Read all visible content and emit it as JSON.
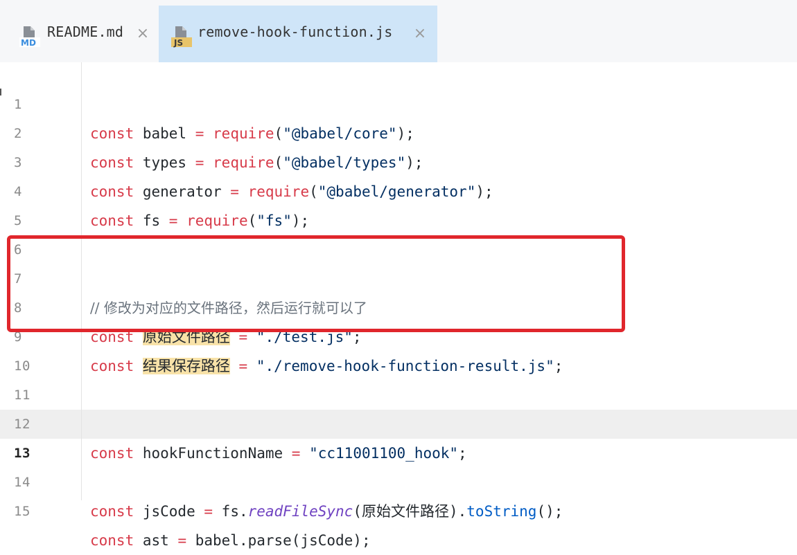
{
  "tabs": [
    {
      "icon": "markdown-file-icon",
      "badge": "MD",
      "label": "README.md",
      "close": "×",
      "active": false
    },
    {
      "icon": "javascript-file-icon",
      "badge": "JS",
      "label": "remove-hook-function.js",
      "close": "×",
      "active": true
    }
  ],
  "colors": {
    "highlight_box": "#e0262c",
    "active_tab": "#cfe5f8",
    "keyword": "#d73a49",
    "string": "#032f62"
  },
  "lines": {
    "l1": {
      "n": "1",
      "kw": "const",
      "name": " babel ",
      "op": "=",
      "fn": " require",
      "open": "(",
      "str": "\"@babel/core\"",
      "close": ");"
    },
    "l2": {
      "n": "2",
      "kw": "const",
      "name": " types ",
      "op": "=",
      "fn": " require",
      "open": "(",
      "str": "\"@babel/types\"",
      "close": ");"
    },
    "l3": {
      "n": "3",
      "kw": "const",
      "name": " generator ",
      "op": "=",
      "fn": " require",
      "open": "(",
      "str": "\"@babel/generator\"",
      "close": ");"
    },
    "l4": {
      "n": "4",
      "kw": "const",
      "name": " fs ",
      "op": "=",
      "fn": " require",
      "open": "(",
      "str": "\"fs\"",
      "close": ");"
    },
    "l5": {
      "n": "5"
    },
    "l6": {
      "n": "6"
    },
    "l7": {
      "n": "7",
      "comment": "// 修改为对应的文件路径，然后运行就可以了"
    },
    "l8": {
      "n": "8",
      "kw": "const",
      "var": "原始文件路径",
      "op": "=",
      "str": "\"./test.js\"",
      "close": ";"
    },
    "l9": {
      "n": "9",
      "kw": "const",
      "var": "结果保存路径",
      "op": "=",
      "str": "\"./remove-hook-function-result.js\"",
      "close": ";"
    },
    "l10": {
      "n": "10"
    },
    "l11": {
      "n": "11"
    },
    "l12": {
      "n": "12",
      "kw": "const",
      "name": " hookFunctionName ",
      "op": "=",
      "str": "\"cc11001100_hook\"",
      "close": ";"
    },
    "l13": {
      "n": "13"
    },
    "l14": {
      "n": "14",
      "kw": "const",
      "name": " jsCode ",
      "op": "=",
      "obj": " fs.",
      "method": "readFileSync",
      "arg_open": "(",
      "arg": "原始文件路径",
      "arg_close": ").",
      "method2": "toString",
      "close": "();"
    },
    "l15": {
      "n": "15",
      "kw": "const",
      "name": " ast ",
      "op": "=",
      "rest": " babel.parse(jsCode);"
    }
  }
}
